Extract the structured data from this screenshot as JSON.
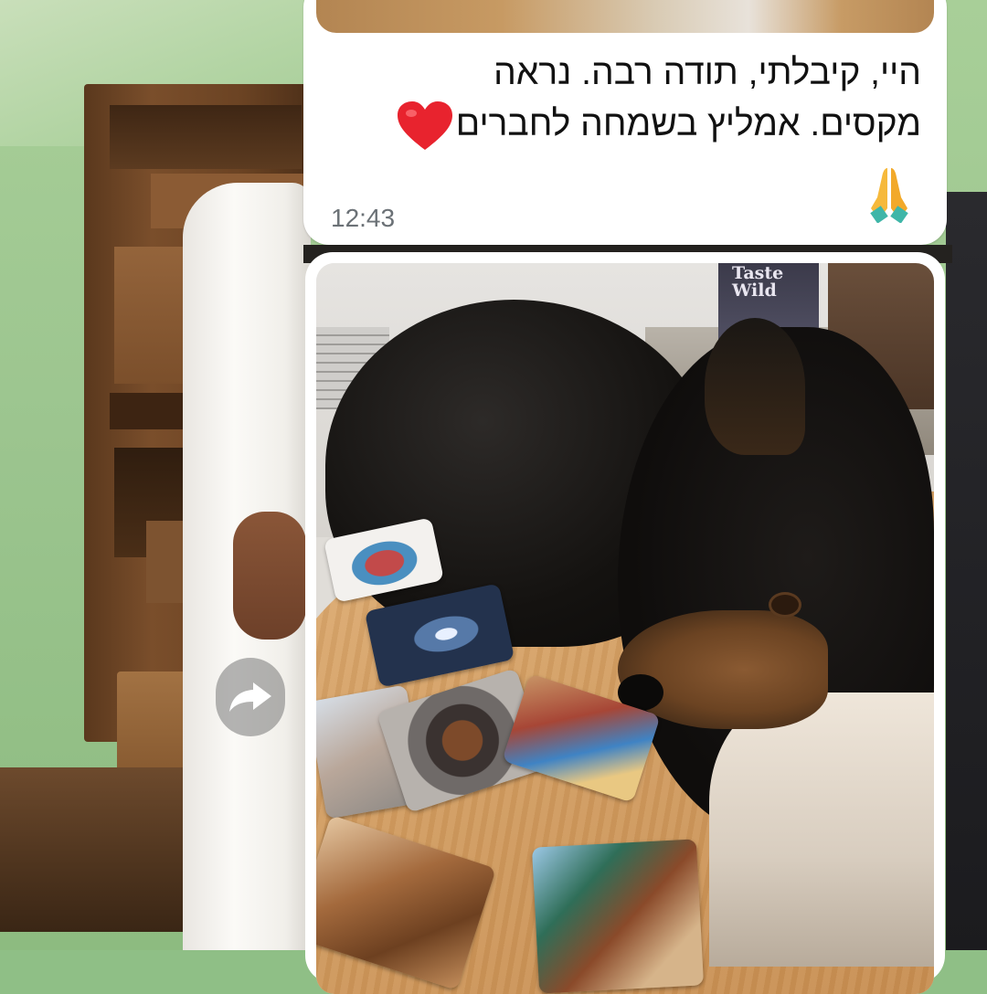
{
  "message": {
    "lines": [
      "היי, קיבלתי, תודה רבה. נראה",
      "מקסים.  אמליץ בשמחה לחברים"
    ],
    "emoji_heart": "heart-emoji",
    "emoji_pray": "folded-hands-emoji",
    "time": "12:43"
  },
  "image_message": {
    "bag_text_line1": "Taste",
    "bag_text_line2": "Wild"
  },
  "forward_button": {
    "icon": "forward-arrow-icon"
  },
  "colors": {
    "bubble_bg": "#ffffff",
    "time_text": "#6b7176",
    "heart": "#e8232e"
  }
}
